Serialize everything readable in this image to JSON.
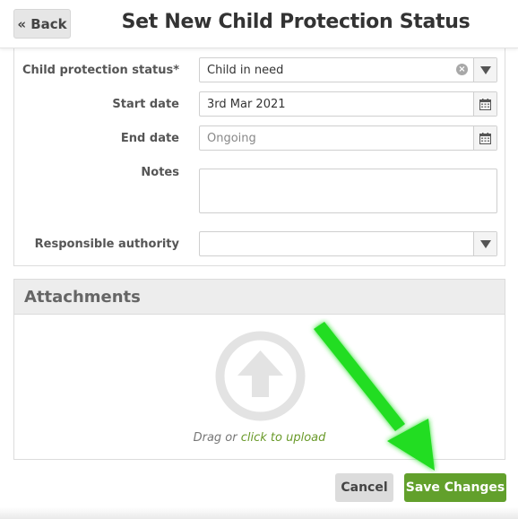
{
  "header": {
    "back_label": "« Back",
    "title": "Set New Child Protection Status"
  },
  "form": {
    "status": {
      "label": "Child protection status*",
      "value": "Child in need"
    },
    "start_date": {
      "label": "Start date",
      "value": "3rd Mar 2021"
    },
    "end_date": {
      "label": "End date",
      "placeholder": "Ongoing"
    },
    "notes": {
      "label": "Notes",
      "value": ""
    },
    "authority": {
      "label": "Responsible authority",
      "value": ""
    }
  },
  "attachments": {
    "title": "Attachments",
    "drag_text": "Drag or",
    "upload_link": "click to upload"
  },
  "actions": {
    "cancel_label": "Cancel",
    "save_label": "Save Changes"
  },
  "colors": {
    "save_button": "#62a02c",
    "annotation_arrow": "#22dd22",
    "upload_link": "#6a9a2a"
  },
  "icons": {
    "clear": "clear-icon",
    "dropdown": "chevron-down-icon",
    "calendar": "calendar-icon",
    "upload": "upload-arrow-icon"
  }
}
